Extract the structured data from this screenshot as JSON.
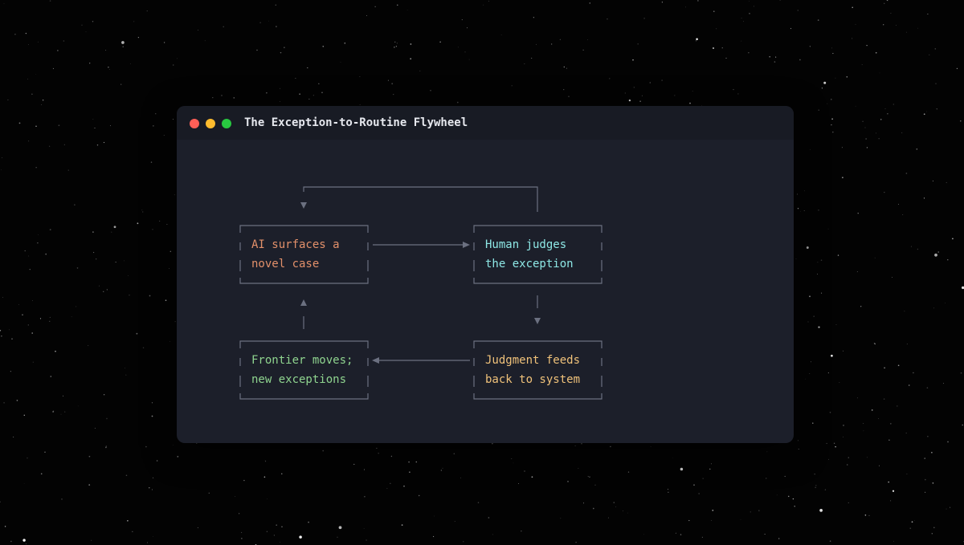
{
  "window": {
    "title": "The Exception-to-Routine Flywheel"
  },
  "diagram": {
    "nodes": [
      {
        "id": "ai",
        "lines": [
          "AI surfaces a",
          "novel case"
        ],
        "color": "#e2906a"
      },
      {
        "id": "human",
        "lines": [
          "Human judges",
          "the exception"
        ],
        "color": "#8ee8e6"
      },
      {
        "id": "judgment",
        "lines": [
          "Judgment feeds",
          "back to system"
        ],
        "color": "#f0c27a"
      },
      {
        "id": "frontier",
        "lines": [
          "Frontier moves;",
          "new exceptions"
        ],
        "color": "#8fd48f"
      }
    ],
    "edges": [
      {
        "from": "ai",
        "to": "human"
      },
      {
        "from": "human",
        "to": "judgment"
      },
      {
        "from": "judgment",
        "to": "frontier"
      },
      {
        "from": "frontier",
        "to": "ai"
      },
      {
        "from": "human",
        "to": "ai"
      }
    ]
  },
  "colors": {
    "connector": "#6b7080",
    "window_bg": "#1c1f2a",
    "titlebar_bg": "#181b24"
  }
}
